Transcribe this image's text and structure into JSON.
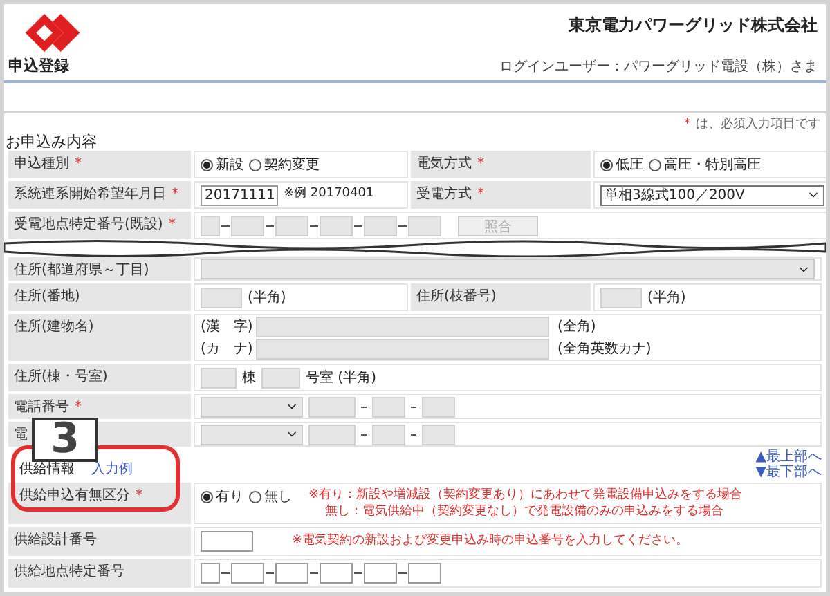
{
  "header": {
    "company": "東京電力パワーグリッド株式会社",
    "page_title": "申込登録",
    "login_user": "ログインユーザー：パワーグリッド電設（株）さま"
  },
  "required_note": {
    "mark": "*",
    "text": "は、必須入力項目です"
  },
  "application": {
    "title": "お申込み内容",
    "type": {
      "label": "申込種別",
      "required": true,
      "options": [
        {
          "label": "新設",
          "selected": true
        },
        {
          "label": "契約変更",
          "selected": false
        }
      ]
    },
    "electric_method": {
      "label": "電気方式",
      "required": true,
      "options": [
        {
          "label": "低圧",
          "selected": true
        },
        {
          "label": "高圧・特別高圧",
          "selected": false
        }
      ]
    },
    "start_date": {
      "label": "系統連系開始希望年月日",
      "required": true,
      "value": "20171111",
      "hint": "※例 20170401"
    },
    "receiving_method": {
      "label": "受電方式",
      "required": true,
      "value": "単相3線式100／200V"
    },
    "point_id": {
      "label": "受電地点特定番号(既設)",
      "required": true,
      "disabled": true,
      "button": "照合"
    }
  },
  "address": {
    "prefecture": {
      "label": "住所(都道府県～丁目)",
      "disabled": true
    },
    "banchi": {
      "label": "住所(番地)",
      "note": "(半角)"
    },
    "branch": {
      "label": "住所(枝番号)",
      "note": "(半角)"
    },
    "building": {
      "label": "住所(建物名)",
      "lines": [
        {
          "prefix": "(漢　字)",
          "note": "(全角)"
        },
        {
          "prefix": "(カ　ナ)",
          "note": "(全角英数カナ)"
        }
      ]
    },
    "room": {
      "label": "住所(棟・号室)",
      "unit1": "棟",
      "unit2": "号室 (半角)"
    },
    "phones": [
      {
        "label": "電話番号",
        "required": true
      },
      {
        "label": "電"
      }
    ]
  },
  "supply": {
    "title": "供給情報",
    "example_link": "入力例",
    "nav": [
      "▲最上部へ",
      "▼最下部へ"
    ],
    "presence": {
      "label": "供給申込有無区分",
      "required": true,
      "options": [
        {
          "label": "有り",
          "selected": true
        },
        {
          "label": "無し",
          "selected": false
        }
      ],
      "notes": [
        "※有り：新設や増減設（契約変更あり）にあわせて発電設備申込みをする場合",
        "無し：電気供給中（契約変更なし）で発電設備のみの申込みをする場合"
      ]
    },
    "design_no": {
      "label": "供給設計番号",
      "note": "※電気契約の新設および変更申込み時の申込番号を入力してください。"
    },
    "point_id": {
      "label": "供給地点特定番号",
      "disabled": false
    }
  },
  "callout": {
    "step": "3"
  }
}
